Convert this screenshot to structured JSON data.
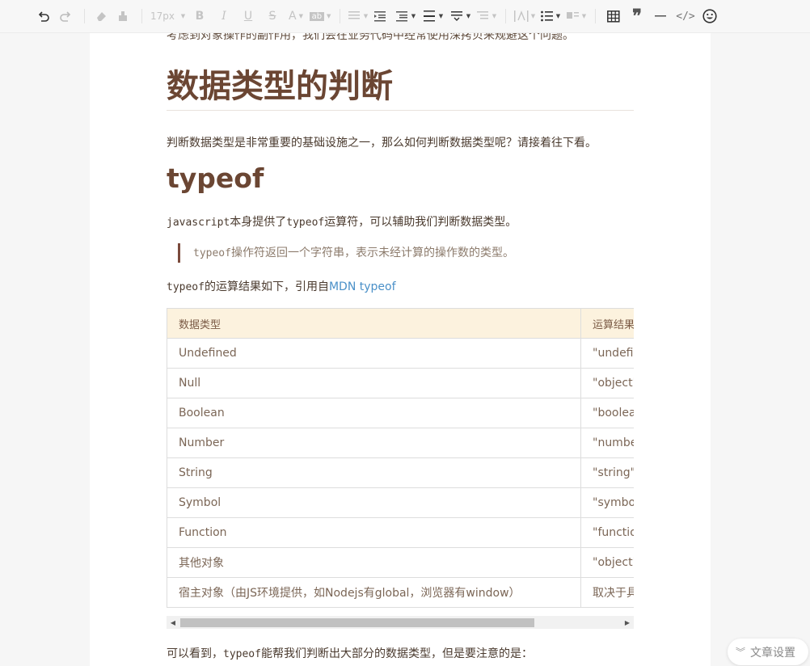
{
  "toolbar": {
    "font_size": "17px",
    "bold": "B",
    "italic": "I",
    "underline": "U",
    "strike": "S",
    "font_color": "A",
    "highlight": "ab"
  },
  "doc": {
    "cut_line": "考虑到对象操作的副作用，我们会在业务代码中经常使用深拷贝来规避这个问题。",
    "h1": "数据类型的判断",
    "p1": "判断数据类型是非常重要的基础设施之一，那么如何判断数据类型呢？请接着往下看。",
    "h2": "typeof",
    "p2_code": "javascript",
    "p2_mid": "本身提供了",
    "p2_code2": "typeof",
    "p2_tail": "运算符，可以辅助我们判断数据类型。",
    "quote_code": "typeof",
    "quote_text": "操作符返回一个字符串，表示未经计算的操作数的类型。",
    "p3_code": "typeof",
    "p3_text": "的运算结果如下，引用自",
    "p3_link": "MDN typeof",
    "table_header": [
      "数据类型",
      "运算结果"
    ],
    "table_rows": [
      [
        "Undefined",
        "\"undefined\""
      ],
      [
        "Null",
        "\"object\""
      ],
      [
        "Boolean",
        "\"boolean\""
      ],
      [
        "Number",
        "\"number\""
      ],
      [
        "String",
        "\"string\""
      ],
      [
        "Symbol",
        "\"symbol\""
      ],
      [
        "Function",
        "\"function\""
      ],
      [
        "其他对象",
        "\"object\""
      ],
      [
        "宿主对象（由JS环境提供，如Nodejs有global，浏览器有window）",
        "取决于具体实现"
      ]
    ],
    "p4_pre": "可以看到，",
    "p4_code": "typeof",
    "p4_tail": "能帮我们判断出大部分的数据类型，但是要注意的是："
  },
  "settings": {
    "label": "文章设置"
  }
}
